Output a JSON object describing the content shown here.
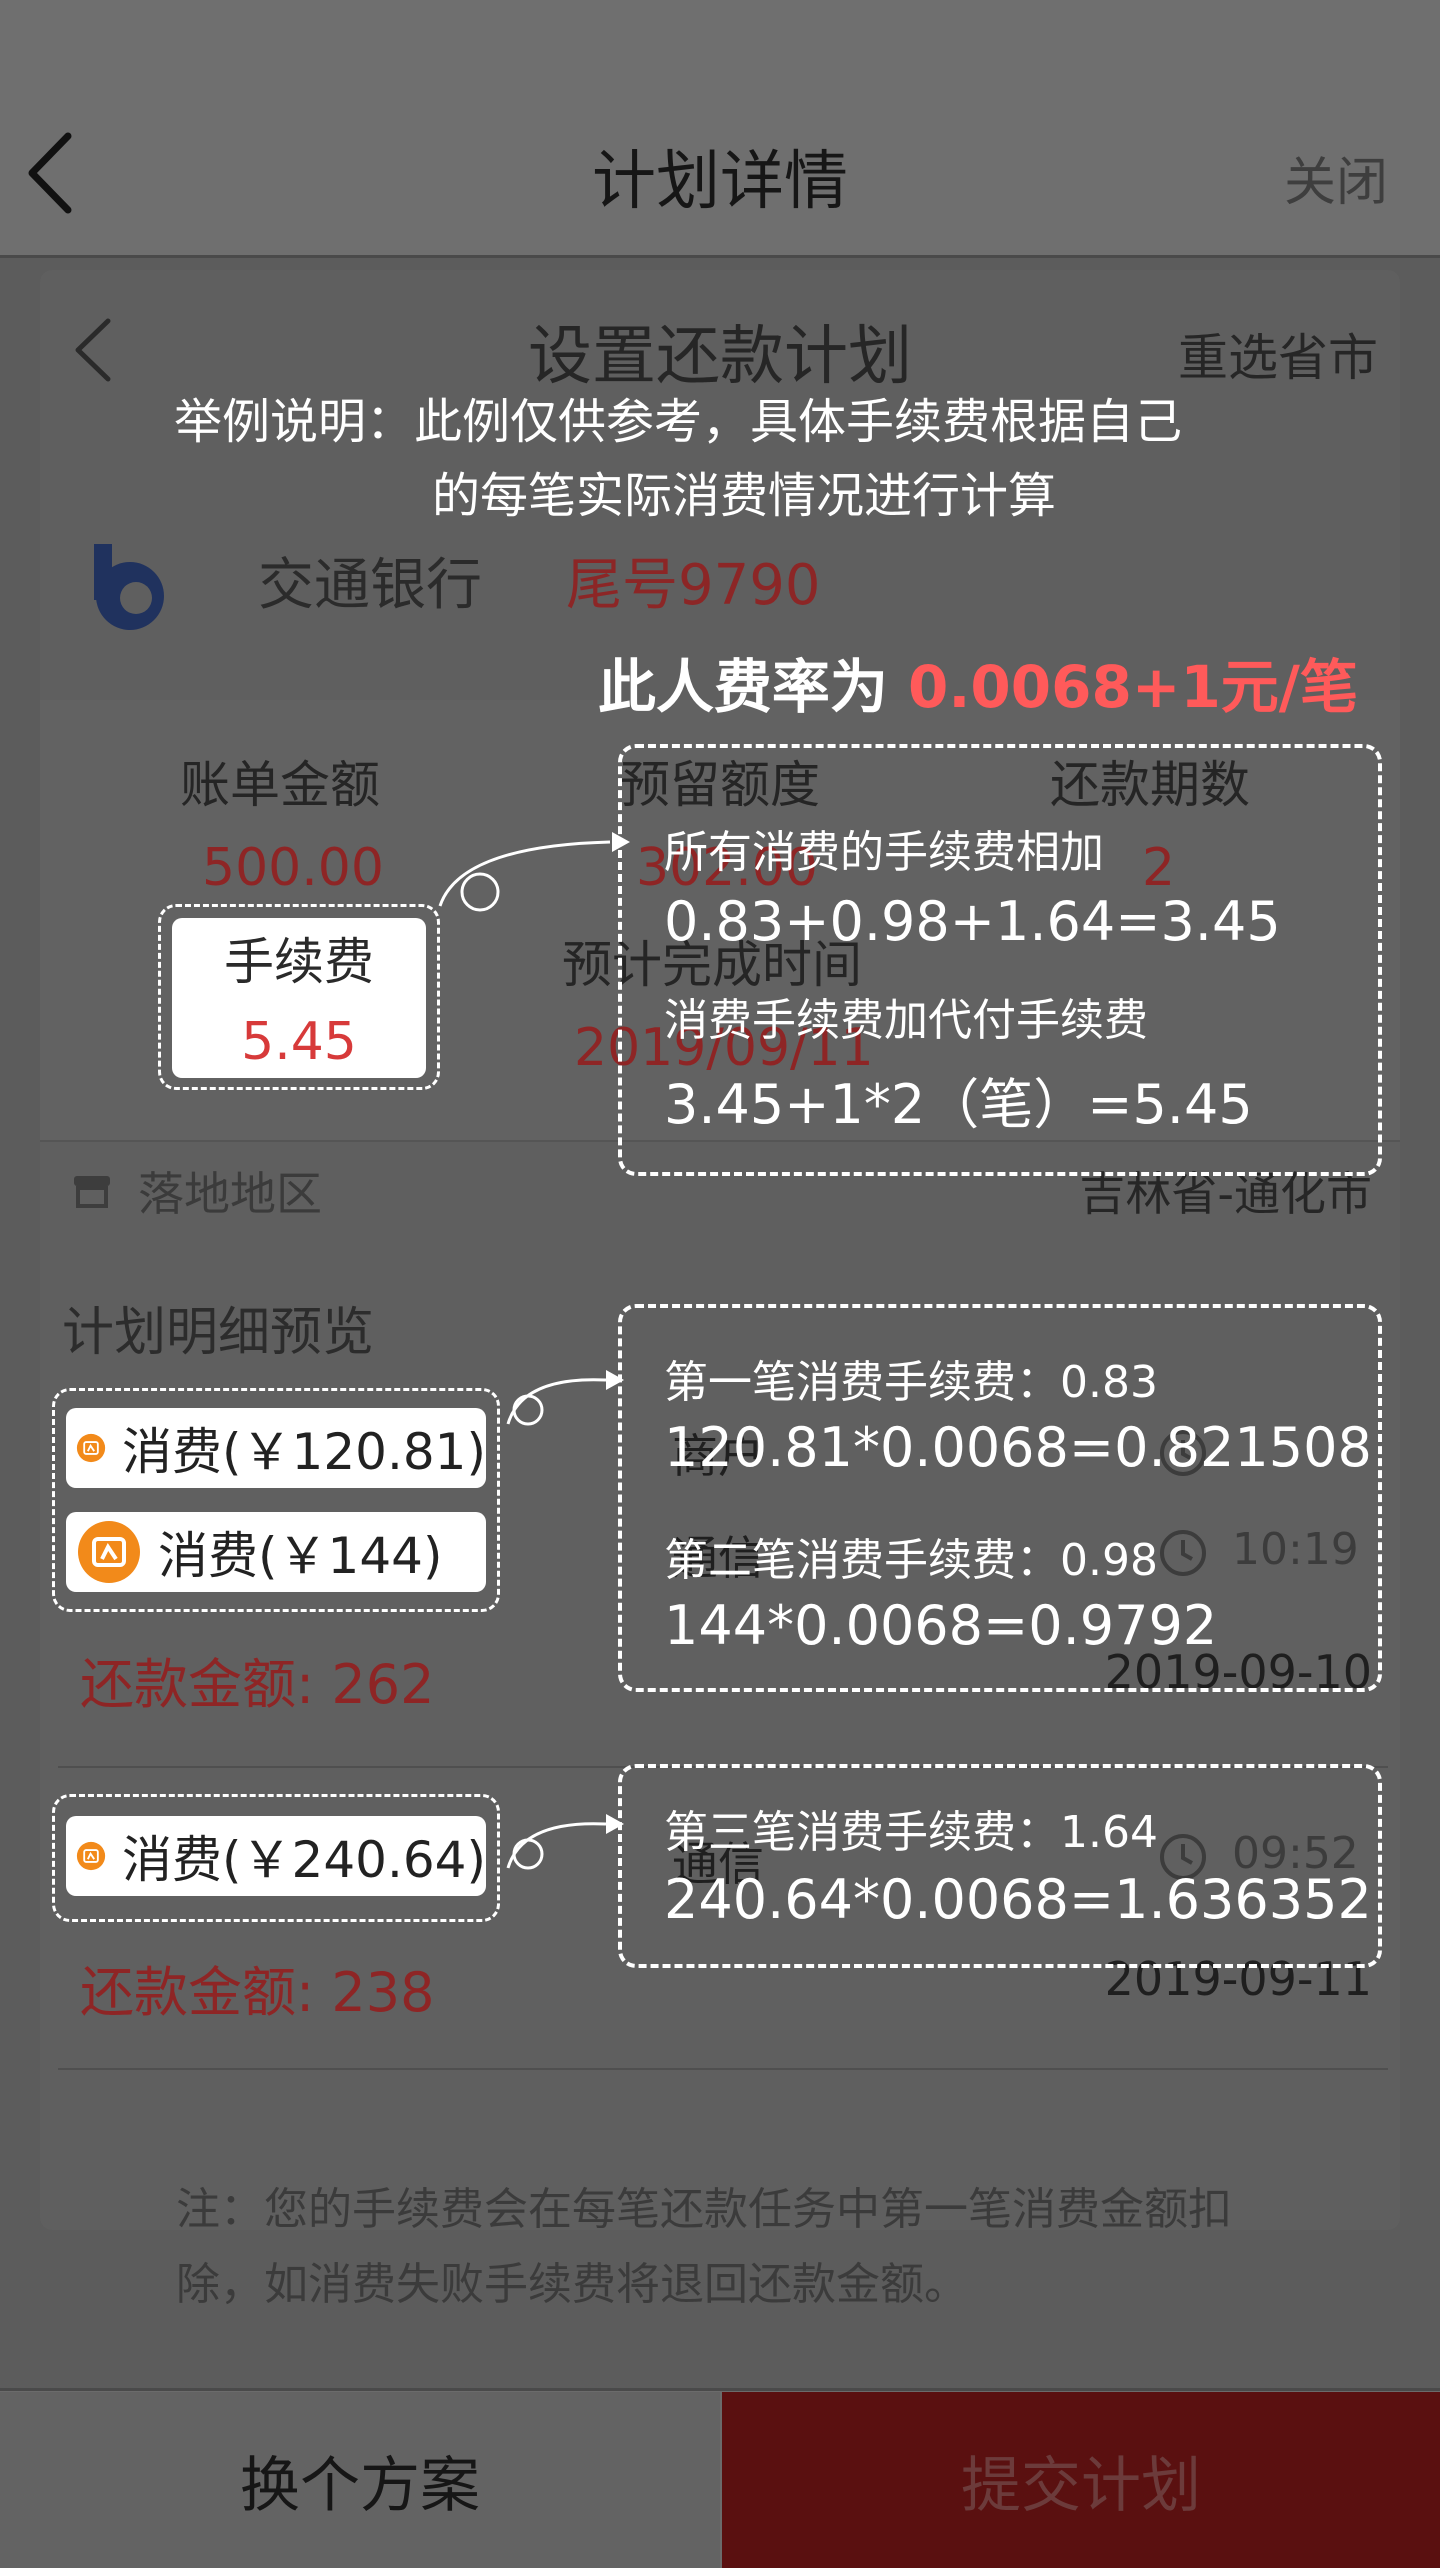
{
  "header": {
    "title": "计划详情",
    "close_label": "关闭"
  },
  "plan": {
    "title": "设置还款计划",
    "reselect_label": "重选省市",
    "bank_name": "交通银行",
    "card_tail": "尾号9790",
    "stats": {
      "bill_amount_label": "账单金额",
      "bill_amount_value": "500.00",
      "reserve_label": "预留额度",
      "reserve_value": "302.00",
      "periods_label": "还款期数",
      "periods_value": "2",
      "finish_time_label": "预计完成时间",
      "finish_time_value": "2019/09/11"
    },
    "region_label": "落地地区",
    "region_value": "吉林省-通化市",
    "preview_title": "计划明细预览",
    "tasks": [
      {
        "rows": [
          {
            "merchant": "商户",
            "time": ""
          },
          {
            "merchant": "通信",
            "time": "10:19"
          }
        ],
        "repay_label": "还款金额: 262",
        "date": "2019-09-10"
      },
      {
        "rows": [
          {
            "merchant": "通信",
            "time": "09:52"
          }
        ],
        "repay_label": "还款金额: 238",
        "date": "2019-09-11"
      }
    ],
    "note": "注：您的手续费会在每笔还款任务中第一笔消费金额扣除，如消费失败手续费将退回还款金额。"
  },
  "footer": {
    "switch_label": "换个方案",
    "submit_label": "提交计划"
  },
  "overlay": {
    "caption_line1": "举例说明：此例仅供参考，具体手续费根据自己",
    "caption_line2": "的每笔实际消费情况进行计算",
    "rate_prefix": "此人费率为 ",
    "rate_value": "0.0068+1元/笔",
    "fee_chip": {
      "label": "手续费",
      "value": "5.45"
    },
    "fee_box": {
      "line1": "所有消费的手续费相加",
      "line2": "0.83+0.98+1.64=3.45",
      "line3": "消费手续费加代付手续费",
      "line4": "3.45+1*2（笔）=5.45"
    },
    "txn_chips": [
      "消费(￥120.81)",
      "消费(￥144)",
      "消费(￥240.64)"
    ],
    "calc_box1": {
      "line1": "第一笔消费手续费：0.83",
      "line2": "120.81*0.0068=0.821508",
      "line3": "第二笔消费手续费：0.98",
      "line4": "144*0.0068=0.9792"
    },
    "calc_box2": {
      "line1": "第三笔消费手续费：1.64",
      "line2": "240.64*0.0068=1.636352"
    }
  },
  "colors": {
    "accent_red": "#d73a3a",
    "rate_red": "#ff5a5a",
    "icon_orange": "#f28a1a"
  }
}
